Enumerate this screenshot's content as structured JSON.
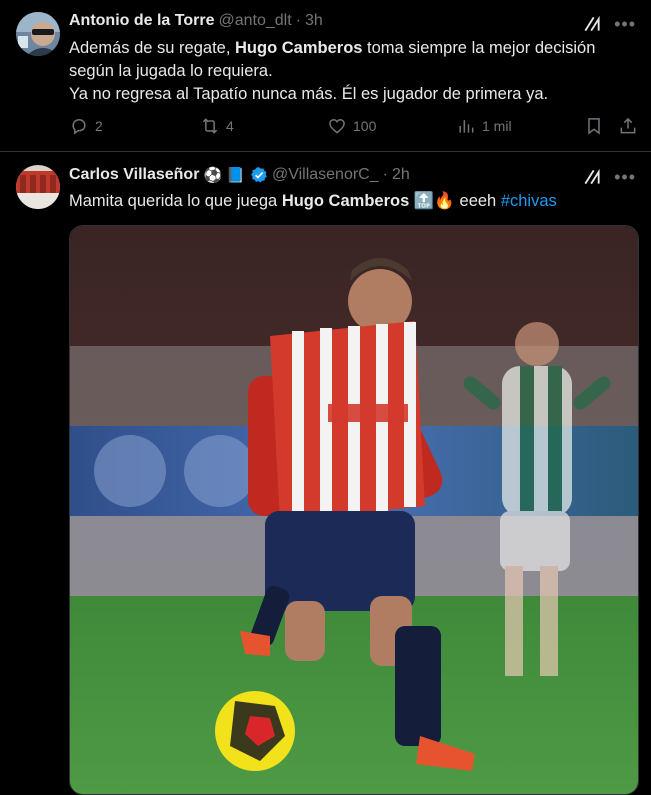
{
  "tweets": [
    {
      "author_name": "Antonio de la Torre",
      "handle": "@anto_dlt",
      "separator": "·",
      "time": "3h",
      "text_part1": "Además de su regate, ",
      "text_bold1": "Hugo Camberos",
      "text_part2": " toma siempre la mejor decisión según la jugada lo requiera.",
      "text_line2": "Ya no regresa al Tapatío nunca más. Él es jugador de primera ya.",
      "replies": "2",
      "reposts": "4",
      "likes": "100",
      "views": "1 mil"
    },
    {
      "author_name": "Carlos Villaseñor",
      "badges": "⚽ 📘",
      "handle": "@VillasenorC_",
      "separator": "·",
      "time": "2h",
      "text_part1": "Mamita querida lo que juega ",
      "text_bold1": "Hugo Camberos",
      "text_emoji": "🔝🔥",
      "text_part2": " eeeh ",
      "hashtag": "#chivas"
    }
  ],
  "colors": {
    "background": "#000000",
    "text": "#e7e9ea",
    "muted": "#71767b",
    "accent": "#1d9bf0",
    "divider": "#2f3336"
  },
  "icons": {
    "reply": "reply-icon",
    "repost": "repost-icon",
    "like": "heart-icon",
    "views": "views-icon",
    "bookmark": "bookmark-icon",
    "share": "share-icon",
    "grok": "grok-icon",
    "more": "more-icon",
    "verified": "verified-icon"
  }
}
